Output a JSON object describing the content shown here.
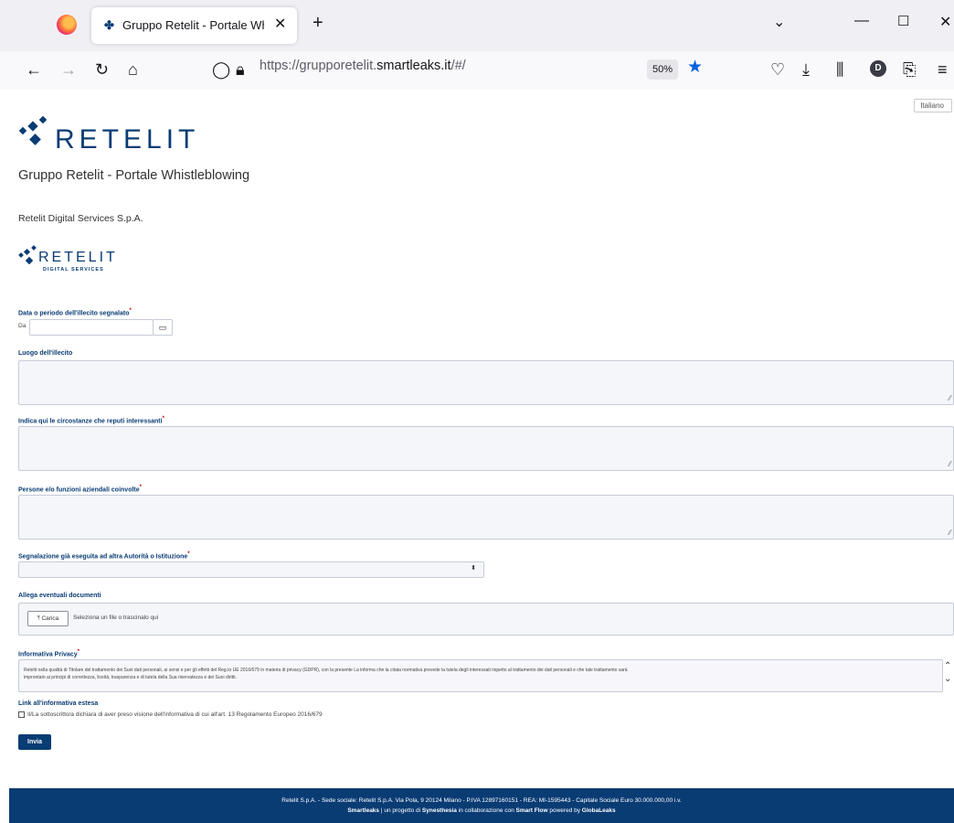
{
  "browser": {
    "tab_title": "Gruppo Retelit - Portale Whistle",
    "url_prefix": "https://grupporetelit.",
    "url_domain": "smartleaks.it",
    "url_suffix": "/#/",
    "zoom": "50%",
    "profile_initial": "D"
  },
  "page": {
    "language": "Italiano",
    "logo_text": "RETELIT",
    "title": "Gruppo Retelit - Portale Whistleblowing",
    "company": "Retelit Digital Services S.p.A.",
    "logo2_text": "RETELIT",
    "logo2_sub": "DIGITAL SERVICES"
  },
  "form": {
    "date_label": "Data o periodo dell'illecito segnalato",
    "date_from": "Da",
    "place_label": "Luogo dell'illecito",
    "circumstances_label": "Indica qui le circostanze che reputi interessanti",
    "persons_label": "Persone e/o funzioni aziendali coinvolte",
    "authority_label": "Segnalazione già eseguita ad altra Autorità o Istituzione",
    "attach_label": "Allega eventuali documenti",
    "upload_button": "Carica",
    "upload_hint": "Seleziona un file o trascinalo qui",
    "privacy_label": "Informativa Privacy",
    "privacy_text_1": "Retelit nella qualità di Titolare del trattamento dei Suoi dati personali, ai sensi e per gli effetti del Reg.to UE 2016/679 in materia di privacy (GDPR), con la presente La informa che la citata normativa prevede la tutela degli interessati rispetto al trattamento dei dati personali e che tale trattamento sarà",
    "privacy_text_2": "improntato ai principi di correttezza, liceità, trasparenza e di tutela della Sua riservatezza e dei Suoi diritti.",
    "privacy_link": "Link all'informativa estesa",
    "consent_text": "Il/La sottoscritto/a dichiara di aver preso visione dell'informativa di cui all'art. 13 Regolamento Europeo 2016/679",
    "submit": "Invia"
  },
  "footer": {
    "line1": "Retelit S.p.A. - Sede sociale: Retelit S.p.A. Via Pola, 9 20124 Milano - P.IVA 12897160151 - REA: MI-1595443 - Capitale Sociale Euro 30.000.000,00 i.v.",
    "brand1": "Smartleaks",
    "mid1": " | un progetto di ",
    "brand2": "Synesthesia",
    "mid2": " in collaborazione con ",
    "brand3": "Smart Flow",
    "mid3": " powered by ",
    "brand4": "GlobaLeaks"
  }
}
